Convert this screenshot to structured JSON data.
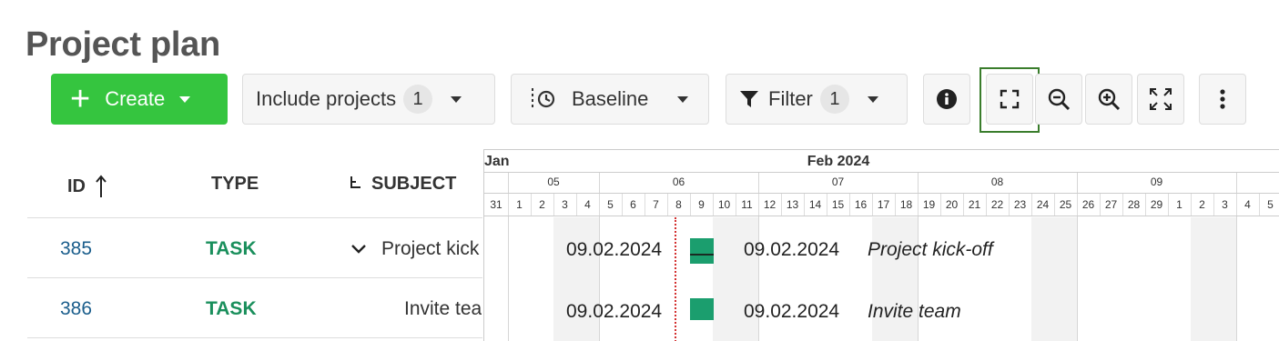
{
  "page": {
    "title": "Project plan"
  },
  "toolbar": {
    "create_label": "Create",
    "include_label": "Include projects",
    "include_count": "1",
    "baseline_label": "Baseline",
    "filter_label": "Filter",
    "filter_count": "1",
    "icons": [
      "info-icon",
      "fullscreen-icon",
      "zoom-out-icon",
      "zoom-in-icon",
      "zoom-to-fit-icon",
      "more-icon"
    ]
  },
  "table": {
    "headers": {
      "id": "ID",
      "type": "TYPE",
      "subject": "SUBJECT"
    },
    "rows": [
      {
        "id": "385",
        "type": "TASK",
        "subject": "Project kick-off"
      },
      {
        "id": "386",
        "type": "TASK",
        "subject": "Invite team"
      }
    ]
  },
  "gantt": {
    "months": [
      "Jan",
      "Feb 2024"
    ],
    "weeks": [
      "05",
      "06",
      "07",
      "08",
      "09"
    ],
    "days": [
      "31",
      "1",
      "2",
      "3",
      "4",
      "5",
      "6",
      "7",
      "8",
      "9",
      "10",
      "11",
      "12",
      "13",
      "14",
      "15",
      "16",
      "17",
      "18",
      "19",
      "20",
      "21",
      "22",
      "23",
      "24",
      "25",
      "26",
      "27",
      "28",
      "29",
      "1",
      "2",
      "3",
      "4",
      "5"
    ],
    "rows": [
      {
        "start_label": "09.02.2024",
        "end_label": "09.02.2024",
        "subject": "Project kick-off"
      },
      {
        "start_label": "09.02.2024",
        "end_label": "09.02.2024",
        "subject": "Invite team"
      }
    ],
    "colors": {
      "bar": "#1b9e6e",
      "today_line": "#d32f2f",
      "id_link": "#1b5e8c",
      "type_text": "#1a8f5c",
      "create_button": "#35c53f"
    }
  }
}
